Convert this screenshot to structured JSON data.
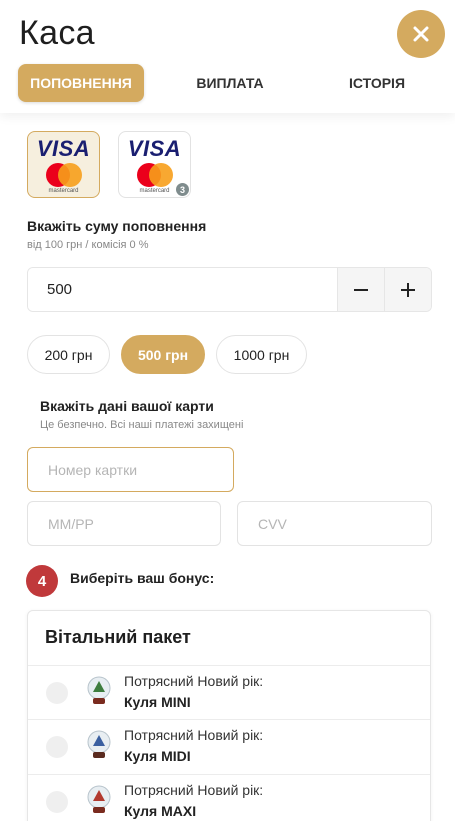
{
  "header": {
    "title": "Каса",
    "tabs": [
      "ПОПОВНЕННЯ",
      "ВИПЛАТА",
      "ІСТОРІЯ"
    ]
  },
  "payment_cards": [
    {
      "brand": "VISA",
      "sub": "mastercard",
      "selected": true
    },
    {
      "brand": "VISA",
      "sub": "mastercard",
      "badge": "3",
      "selected": false
    }
  ],
  "amount": {
    "label": "Вкажіть суму поповнення",
    "hint": "від 100 грн / комісія 0 %",
    "value": "500",
    "minus": "−",
    "plus": "+"
  },
  "quick_amounts": [
    "200 грн",
    "500 грн",
    "1000 грн"
  ],
  "card_details": {
    "label": "Вкажіть дані вашої карти",
    "hint": "Це безпечно. Всі наші платежі захищені",
    "card_number_placeholder": "Номер картки",
    "expiry_placeholder": "ММ/РР",
    "cvv_placeholder": "CVV"
  },
  "bonus": {
    "step": "4",
    "label": "Виберіть ваш бонус:",
    "panel_title": "Вітальний пакет",
    "items": [
      {
        "line1": "Потрясний Новий рік:",
        "line2": "Куля MINI"
      },
      {
        "line1": "Потрясний Новий рік:",
        "line2": "Куля MIDI"
      },
      {
        "line1": "Потрясний Новий рік:",
        "line2": "Куля MAXI"
      }
    ]
  },
  "colors": {
    "accent": "#d4aa5f",
    "badge": "#c0393b"
  }
}
